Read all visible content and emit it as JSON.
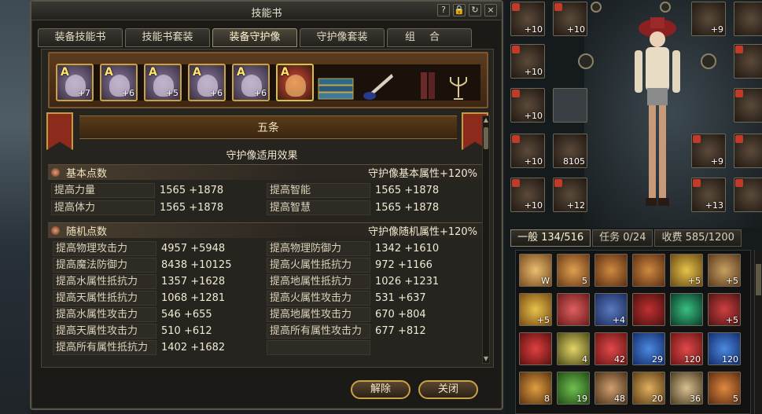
{
  "window": {
    "title": "技能书"
  },
  "titlebar_icons": [
    "?",
    "lock-icon",
    "reset-icon",
    "×"
  ],
  "tabs": [
    {
      "label": "装备技能书",
      "active": false
    },
    {
      "label": "技能书套装",
      "active": false
    },
    {
      "label": "装备守护像",
      "active": true
    },
    {
      "label": "守护像套装",
      "active": false
    },
    {
      "label": "组合",
      "active": false
    }
  ],
  "shelf": {
    "slots": [
      {
        "grade": "A",
        "level": "+7",
        "icon": "guardian-statue-icon"
      },
      {
        "grade": "A",
        "level": "+6",
        "icon": "guardian-statue-icon"
      },
      {
        "grade": "A",
        "level": "+5",
        "icon": "guardian-statue-icon"
      },
      {
        "grade": "A",
        "level": "+6",
        "icon": "guardian-statue-icon"
      },
      {
        "grade": "A",
        "level": "+6",
        "icon": "guardian-statue-icon"
      },
      {
        "grade": "A",
        "level": "",
        "icon": "joker-statue-icon"
      }
    ],
    "decorations": [
      "books-icon",
      "inkwell-quill-icon",
      "book-stack-icon",
      "candelabra-icon"
    ]
  },
  "banner": {
    "title": "五条"
  },
  "effects_title": "守护像适用效果",
  "basic": {
    "name": "基本点数",
    "bonus": "守护像基本属性+120%",
    "rows": [
      {
        "left": {
          "label": "提高力量",
          "value": "1565 +1878"
        },
        "right": {
          "label": "提高智能",
          "value": "1565 +1878"
        }
      },
      {
        "left": {
          "label": "提高体力",
          "value": "1565 +1878"
        },
        "right": {
          "label": "提高智慧",
          "value": "1565 +1878"
        }
      }
    ]
  },
  "random": {
    "name": "随机点数",
    "bonus": "守护像随机属性+120%",
    "rows": [
      {
        "left": {
          "label": "提高物理攻击力",
          "value": "4957 +5948"
        },
        "right": {
          "label": "提高物理防御力",
          "value": "1342 +1610"
        }
      },
      {
        "left": {
          "label": "提高魔法防御力",
          "value": "8438 +10125"
        },
        "right": {
          "label": "提高火属性抵抗力",
          "value": "972 +1166"
        }
      },
      {
        "left": {
          "label": "提高水属性抵抗力",
          "value": "1357 +1628"
        },
        "right": {
          "label": "提高地属性抵抗力",
          "value": "1026 +1231"
        }
      },
      {
        "left": {
          "label": "提高天属性抵抗力",
          "value": "1068 +1281"
        },
        "right": {
          "label": "提高火属性攻击力",
          "value": "531 +637"
        }
      },
      {
        "left": {
          "label": "提高水属性攻击力",
          "value": "546 +655"
        },
        "right": {
          "label": "提高地属性攻击力",
          "value": "670 +804"
        }
      },
      {
        "left": {
          "label": "提高天属性攻击力",
          "value": "510 +612"
        },
        "right": {
          "label": "提高所有属性攻击力",
          "value": "677 +812"
        }
      },
      {
        "left": {
          "label": "提高所有属性抵抗力",
          "value": "1402 +1682"
        },
        "right": {
          "label": "",
          "value": ""
        }
      }
    ]
  },
  "buttons": {
    "dismantle": "解除",
    "close": "关闭"
  },
  "equipment": {
    "left_column": [
      "+10",
      "+10",
      "+10",
      "+10",
      "+10"
    ],
    "second_column": [
      "+10",
      "",
      "",
      "8105",
      "+12"
    ],
    "right_column": [
      "+9",
      "",
      "",
      "+9",
      "+13"
    ]
  },
  "inventory": {
    "tabs": [
      {
        "label": "一般 134/516",
        "active": true
      },
      {
        "label": "任务 0/24",
        "active": false
      },
      {
        "label": "收费 585/1200",
        "active": false
      }
    ],
    "rows": [
      [
        "W",
        "5",
        "",
        "",
        "+5",
        "+5"
      ],
      [
        "+5",
        "",
        "+4",
        "",
        "",
        "+5"
      ],
      [
        "",
        "4",
        "42",
        "29",
        "120",
        "120"
      ],
      [
        "8",
        "19",
        "48",
        "20",
        "36",
        "5"
      ]
    ]
  }
}
